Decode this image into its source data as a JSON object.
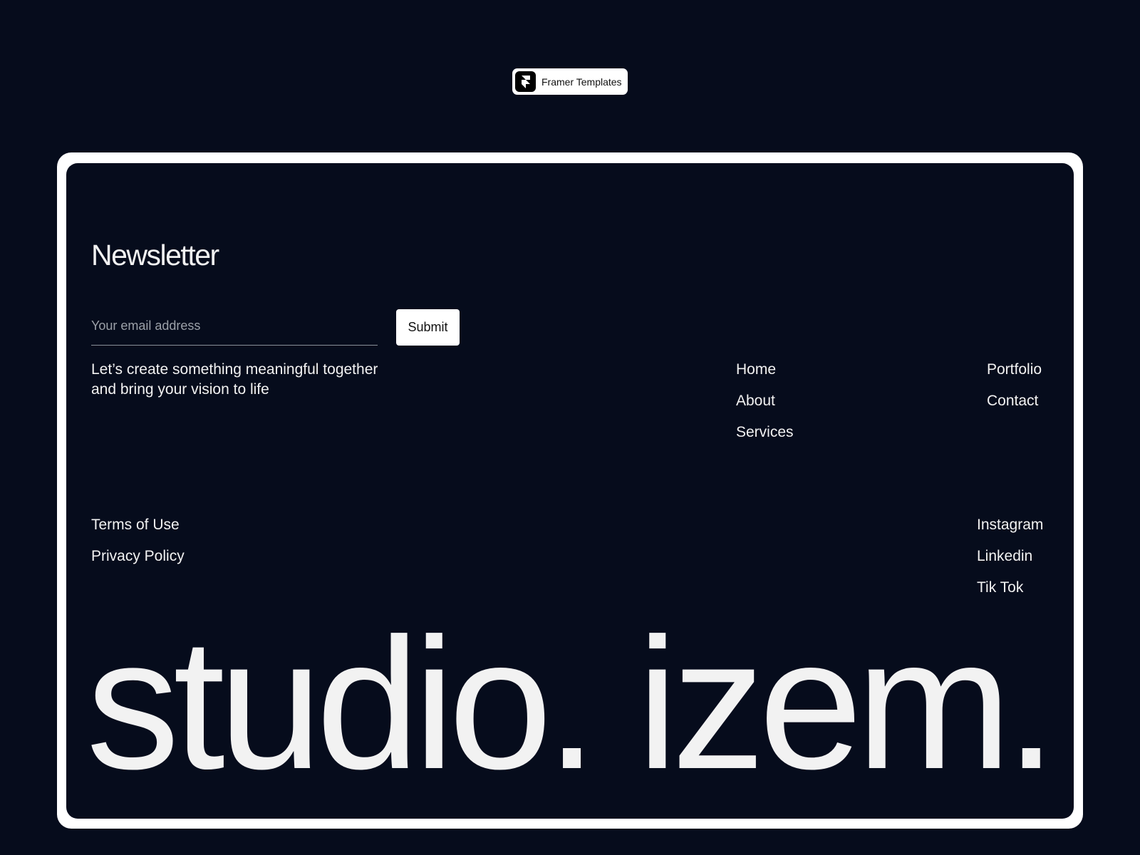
{
  "badge": {
    "label": "Framer Templates",
    "icon": "framer-logo-icon"
  },
  "newsletter": {
    "title": "Newsletter",
    "email_placeholder": "Your email address",
    "email_value": "",
    "submit_label": "Submit"
  },
  "tagline": "Let’s create something meaningful together and bring your vision to life",
  "nav_primary": [
    "Home",
    "About",
    "Services"
  ],
  "nav_secondary": [
    "Portfolio",
    "Contact"
  ],
  "legal": [
    "Terms of Use",
    "Privacy Policy"
  ],
  "social": [
    "Instagram",
    "Linkedin",
    "Tik Tok"
  ],
  "brand": "studio. izem.",
  "colors": {
    "background": "#060c1c",
    "frame": "#ffffff",
    "text": "#f2f2f2",
    "button_bg": "#ffffff",
    "button_text": "#111111"
  }
}
